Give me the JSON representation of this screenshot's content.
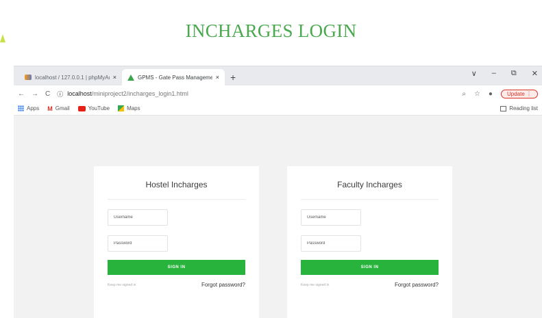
{
  "slide": {
    "title": "INCHARGES LOGIN"
  },
  "browser": {
    "tabs": [
      {
        "label": "localhost / 127.0.0.1 | phpMyAd",
        "close": "×"
      },
      {
        "label": "GPMS - Gate Pass Management",
        "close": "×"
      }
    ],
    "new_tab": "+",
    "window_controls": {
      "dropdown": "∨",
      "minimize": "–",
      "restore": "⧉",
      "close": "✕"
    },
    "nav": {
      "back": "←",
      "forward": "→",
      "reload": "C",
      "info": "ⓘ"
    },
    "address": {
      "host": "localhost",
      "path": "/miniproject2/incharges_login1.html"
    },
    "toolbar_right": {
      "search": "⌕",
      "star": "☆",
      "profile": "●",
      "update": "Update",
      "menu": "⋮"
    },
    "bookmarks": [
      {
        "label": "Apps",
        "icon": "apps-icon"
      },
      {
        "label": "Gmail",
        "icon": "gmail-icon"
      },
      {
        "label": "YouTube",
        "icon": "youtube-icon"
      },
      {
        "label": "Maps",
        "icon": "maps-icon"
      }
    ],
    "reading_list": "Reading list"
  },
  "cards": [
    {
      "heading": "Hostel Incharges",
      "username_placeholder": "Username",
      "password_placeholder": "Password",
      "sign_in": "SIGN IN",
      "keep_signed_in": "Keep me signed in",
      "forgot": "Forgot password?"
    },
    {
      "heading": "Faculty Incharges",
      "username_placeholder": "Username",
      "password_placeholder": "Password",
      "sign_in": "SIGN IN",
      "keep_signed_in": "Keep me signed in",
      "forgot": "Forgot password?"
    }
  ],
  "colors": {
    "accent": "#28b33c",
    "title": "#4aa84f",
    "update": "#d93025"
  }
}
